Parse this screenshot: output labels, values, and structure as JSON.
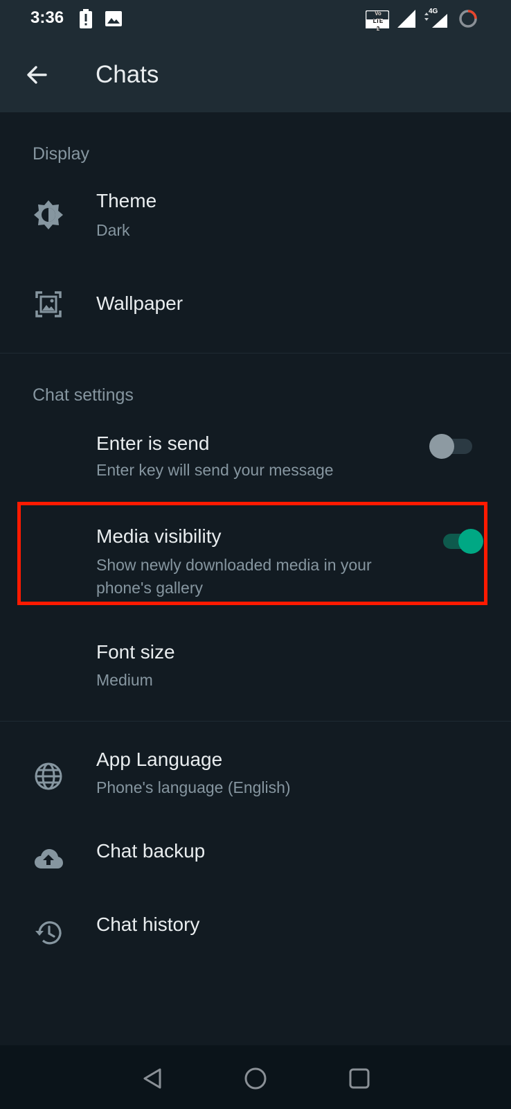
{
  "status_bar": {
    "time": "3:36",
    "icons": [
      "battery-alert-icon",
      "image-icon",
      "volte-lte2-icon",
      "signal-icon",
      "signal-4g-icon",
      "loading-ring-icon"
    ],
    "network_label": "4G",
    "volte_label": "Vo LTE 2"
  },
  "app_bar": {
    "title": "Chats",
    "back_icon": "arrow-left-icon"
  },
  "sections": {
    "display": {
      "header": "Display",
      "theme": {
        "title": "Theme",
        "value": "Dark",
        "icon": "theme-icon"
      },
      "wallpaper": {
        "title": "Wallpaper",
        "icon": "wallpaper-icon"
      }
    },
    "chat_settings": {
      "header": "Chat settings",
      "enter_is_send": {
        "title": "Enter is send",
        "subtitle": "Enter key will send your message",
        "enabled": false
      },
      "media_visibility": {
        "title": "Media visibility",
        "subtitle_line1": "Show newly downloaded media in your",
        "subtitle_line2": "phone's gallery",
        "enabled": true
      },
      "font_size": {
        "title": "Font size",
        "value": "Medium"
      }
    },
    "other": {
      "app_language": {
        "title": "App Language",
        "value": "Phone's language (English)",
        "icon": "globe-icon"
      },
      "chat_backup": {
        "title": "Chat backup",
        "icon": "cloud-upload-icon"
      },
      "chat_history": {
        "title": "Chat history",
        "icon": "history-icon"
      }
    }
  },
  "nav_bar": {
    "icons": [
      "nav-back-icon",
      "nav-home-icon",
      "nav-recents-icon"
    ]
  },
  "colors": {
    "background": "#121b22",
    "app_bar": "#1f2c34",
    "text_primary": "#e9edef",
    "text_secondary": "#8696a0",
    "accent": "#00a884",
    "highlight": "#ff1a00"
  }
}
